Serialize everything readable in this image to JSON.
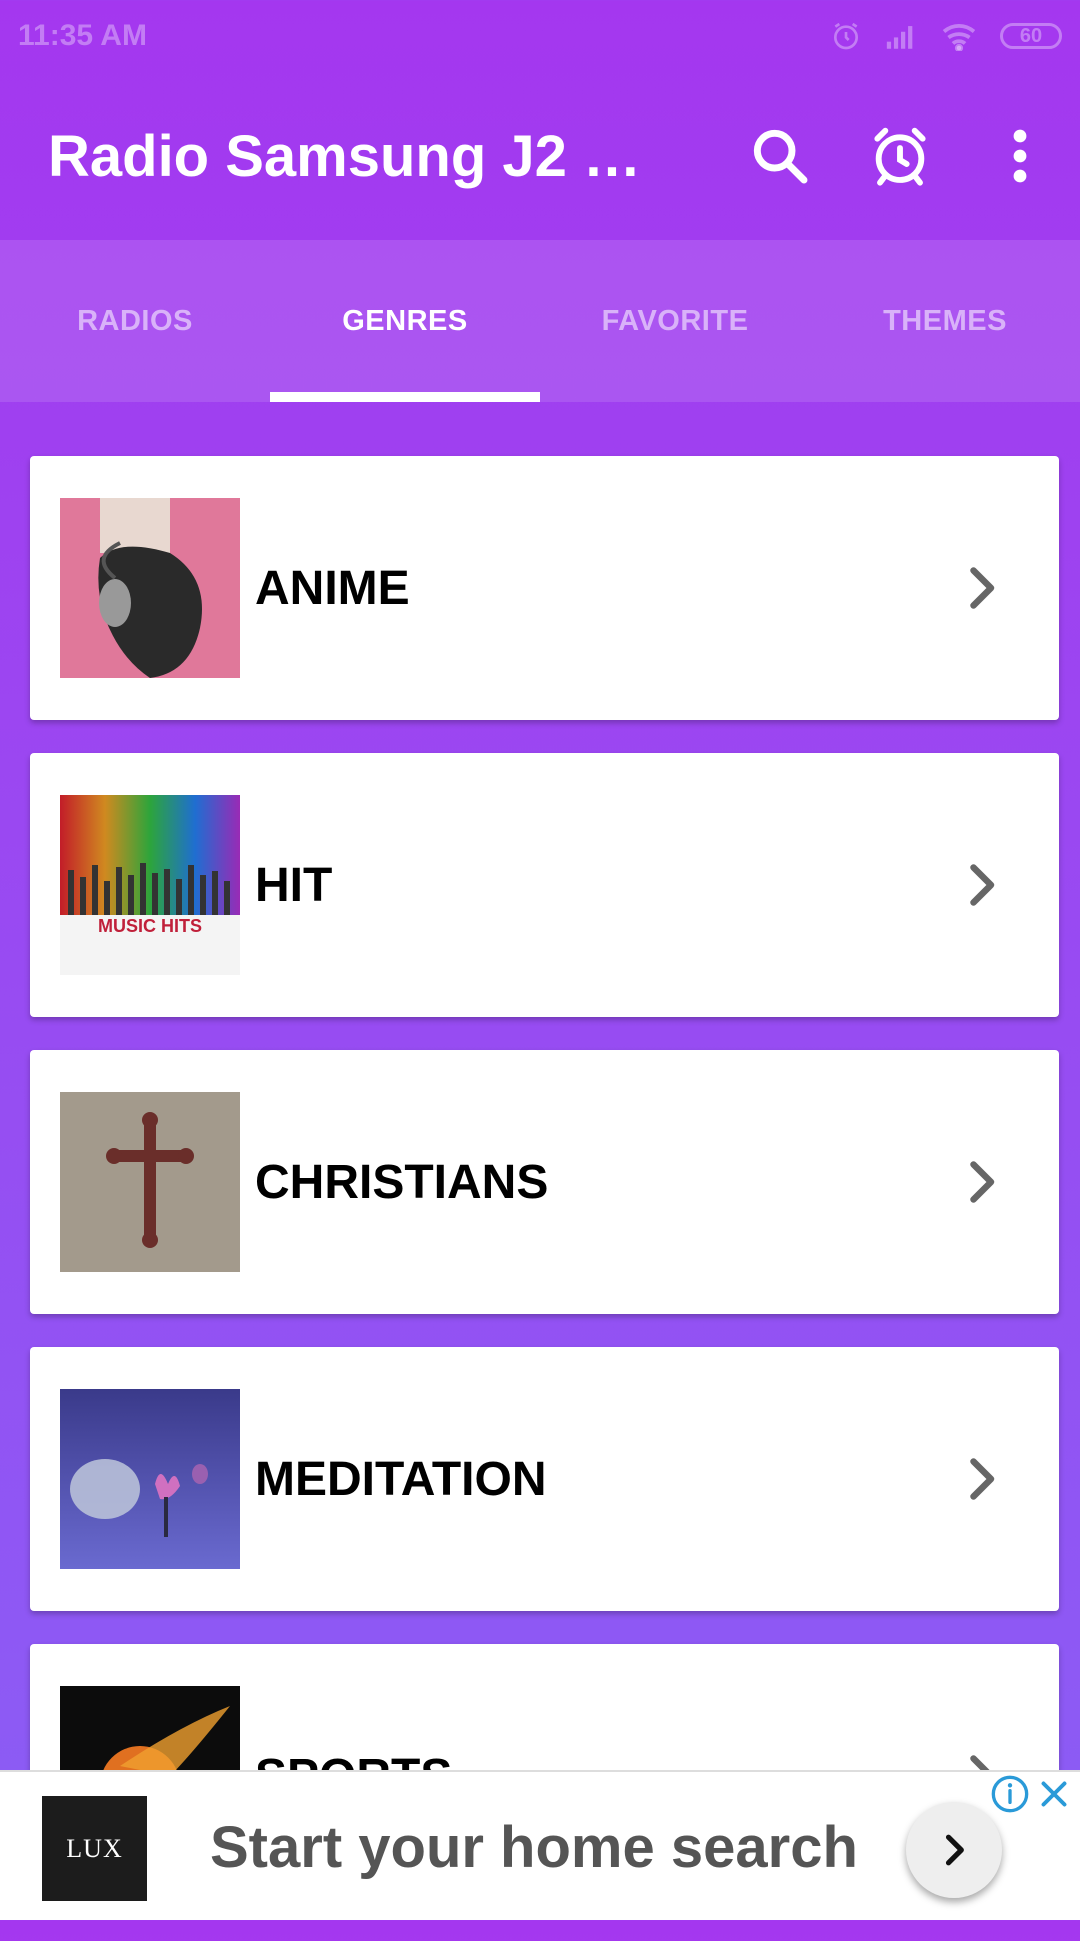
{
  "status_bar": {
    "time": "11:35 AM",
    "battery": "60"
  },
  "app_bar": {
    "title": "Radio Samsung J2 P..."
  },
  "tabs": [
    {
      "label": "RADIOS",
      "active": false
    },
    {
      "label": "GENRES",
      "active": true
    },
    {
      "label": "FAVORITE",
      "active": false
    },
    {
      "label": "THEMES",
      "active": false
    }
  ],
  "genres": [
    {
      "label": "ANIME",
      "thumb": "anime-thumbnail"
    },
    {
      "label": "HIT",
      "thumb": "music-hits-thumbnail",
      "thumb_text": "MUSIC HITS"
    },
    {
      "label": "CHRISTIANS",
      "thumb": "cross-thumbnail"
    },
    {
      "label": "MEDITATION",
      "thumb": "lotus-thumbnail"
    },
    {
      "label": "SPORTS",
      "thumb": "sports-thumbnail"
    }
  ],
  "ad": {
    "logo_text": "LUX",
    "headline": "Start your home search"
  },
  "colors": {
    "accent": "#a437ef",
    "tab_indicator": "#ffffff"
  }
}
